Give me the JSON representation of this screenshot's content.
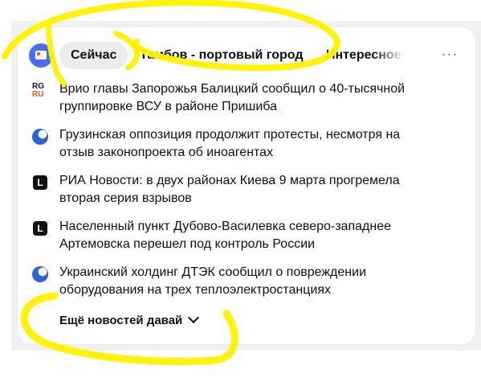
{
  "header": {
    "tabs": [
      {
        "label": "Сейчас",
        "active": true
      },
      {
        "label": "Тамбов - портовый город",
        "active": false
      },
      {
        "label": "Интересное",
        "active": false
      }
    ],
    "more_label": "···"
  },
  "news": [
    {
      "source_icon": "rg-ru-logo",
      "source_text_1": "RG",
      "source_text_2": "RU",
      "title": "Врио главы Запорожья Балицкий сообщил о 40-тысячной группировке ВСУ в районе Пришиба"
    },
    {
      "source_icon": "globe-logo",
      "title": "Грузинская оппозиция продолжит протесты, несмотря на отзыв законопроекта об иноагентах"
    },
    {
      "source_icon": "l-logo",
      "source_text": "L",
      "title": "РИА Новости: в двух районах Киева 9 марта прогремела вторая серия взрывов"
    },
    {
      "source_icon": "l-logo",
      "source_text": "L",
      "title": "Населенный пункт Дубово-Василевка северо-западнее Артемовска перешел под контроль России"
    },
    {
      "source_icon": "globe-logo",
      "title": "Украинский холдинг ДТЭК сообщил о повреждении оборудования на трех теплоэлектростанциях"
    }
  ],
  "more_news_label": "Ещё новостей давай",
  "colors": {
    "highlighter": "#fff200",
    "logo_blue": "#4a6cf7",
    "card_bg": "#ffffff",
    "outer_bg": "#f1f1f3",
    "active_tab_bg": "#ececef"
  }
}
